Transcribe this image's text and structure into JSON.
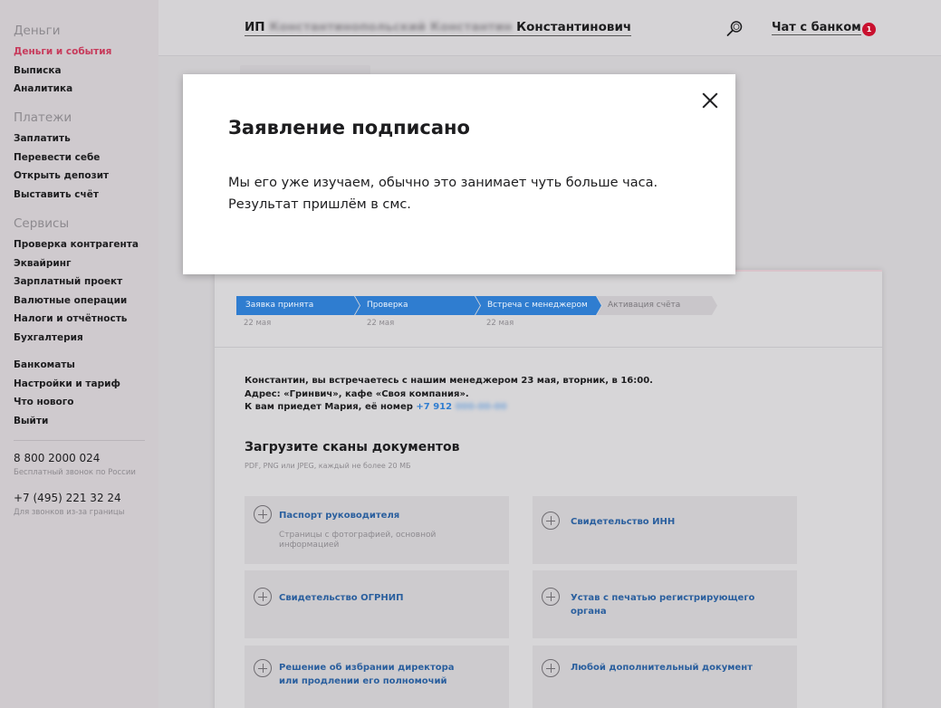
{
  "sidebar": {
    "sections": [
      {
        "title": "Деньги",
        "items": [
          {
            "label": "Деньги и события",
            "active": true
          },
          {
            "label": "Выписка"
          },
          {
            "label": "Аналитика"
          }
        ]
      },
      {
        "title": "Платежи",
        "items": [
          {
            "label": "Заплатить"
          },
          {
            "label": "Перевести себе"
          },
          {
            "label": "Открыть депозит"
          },
          {
            "label": "Выставить счёт"
          }
        ]
      },
      {
        "title": "Сервисы",
        "items": [
          {
            "label": "Проверка контрагента"
          },
          {
            "label": "Эквайринг"
          },
          {
            "label": "Зарплатный проект"
          },
          {
            "label": "Валютные операции"
          },
          {
            "label": "Налоги и отчётность"
          },
          {
            "label": "Бухгалтерия"
          }
        ]
      }
    ],
    "extra": [
      "Банкоматы",
      "Настройки и тариф",
      "Что нового",
      "Выйти"
    ],
    "phones": [
      {
        "number": "8 800 2000 024",
        "note": "Бесплатный звонок по России"
      },
      {
        "number": "+7 (495) 221 32 24",
        "note": "Для звонков из-за границы"
      }
    ]
  },
  "header": {
    "company_prefix": "ИП",
    "company_hidden": "Константинопольский Константин",
    "company_suffix": "Константинович",
    "chat_label": "Чат с банком",
    "chat_badge": "1",
    "search_icon": "search-icon"
  },
  "steps": [
    {
      "label": "Заявка принята",
      "date": "22 мая",
      "done": true
    },
    {
      "label": "Проверка",
      "date": "22 мая",
      "done": true
    },
    {
      "label": "Встреча с менеджером",
      "date": "22 мая",
      "done": true
    },
    {
      "label": "Активация счёта",
      "date": "",
      "done": false
    }
  ],
  "meeting": {
    "line1": "Константин, вы встречаетесь с нашим менеджером 23 мая, вторник, в 16:00.",
    "line2": "Адрес: «Гринвич», кафе «Своя компания».",
    "line3_prefix": "К вам приедет Мария, её номер",
    "phone_visible": "+7 912",
    "phone_hidden": "000-00-00"
  },
  "upload": {
    "title": "Загрузите сканы документов",
    "subtitle": "PDF, PNG или JPEG, каждый не более 20 МБ",
    "docs": [
      {
        "title": "Паспорт руководителя",
        "note": "Страницы с фотографией, основной информацией"
      },
      {
        "title": "Свидетельство ИНН",
        "note": ""
      },
      {
        "title": "Свидетельство ОГРНИП",
        "note": ""
      },
      {
        "title": "Устав с печатью регистрирующего органа",
        "note": ""
      },
      {
        "title": "Решение об избрании директора или продлении его полномочий",
        "note": ""
      },
      {
        "title": "Любой дополнительный документ",
        "note": ""
      }
    ]
  },
  "modal": {
    "title": "Заявление подписано",
    "text": "Мы его уже изучаем, обычно это занимает чуть больше часа. Результат пришлём в смс.",
    "close_icon": "close-icon"
  },
  "colors": {
    "accent": "#2f7dd0",
    "active_nav": "#c73a5b",
    "badge": "#c9102f"
  }
}
